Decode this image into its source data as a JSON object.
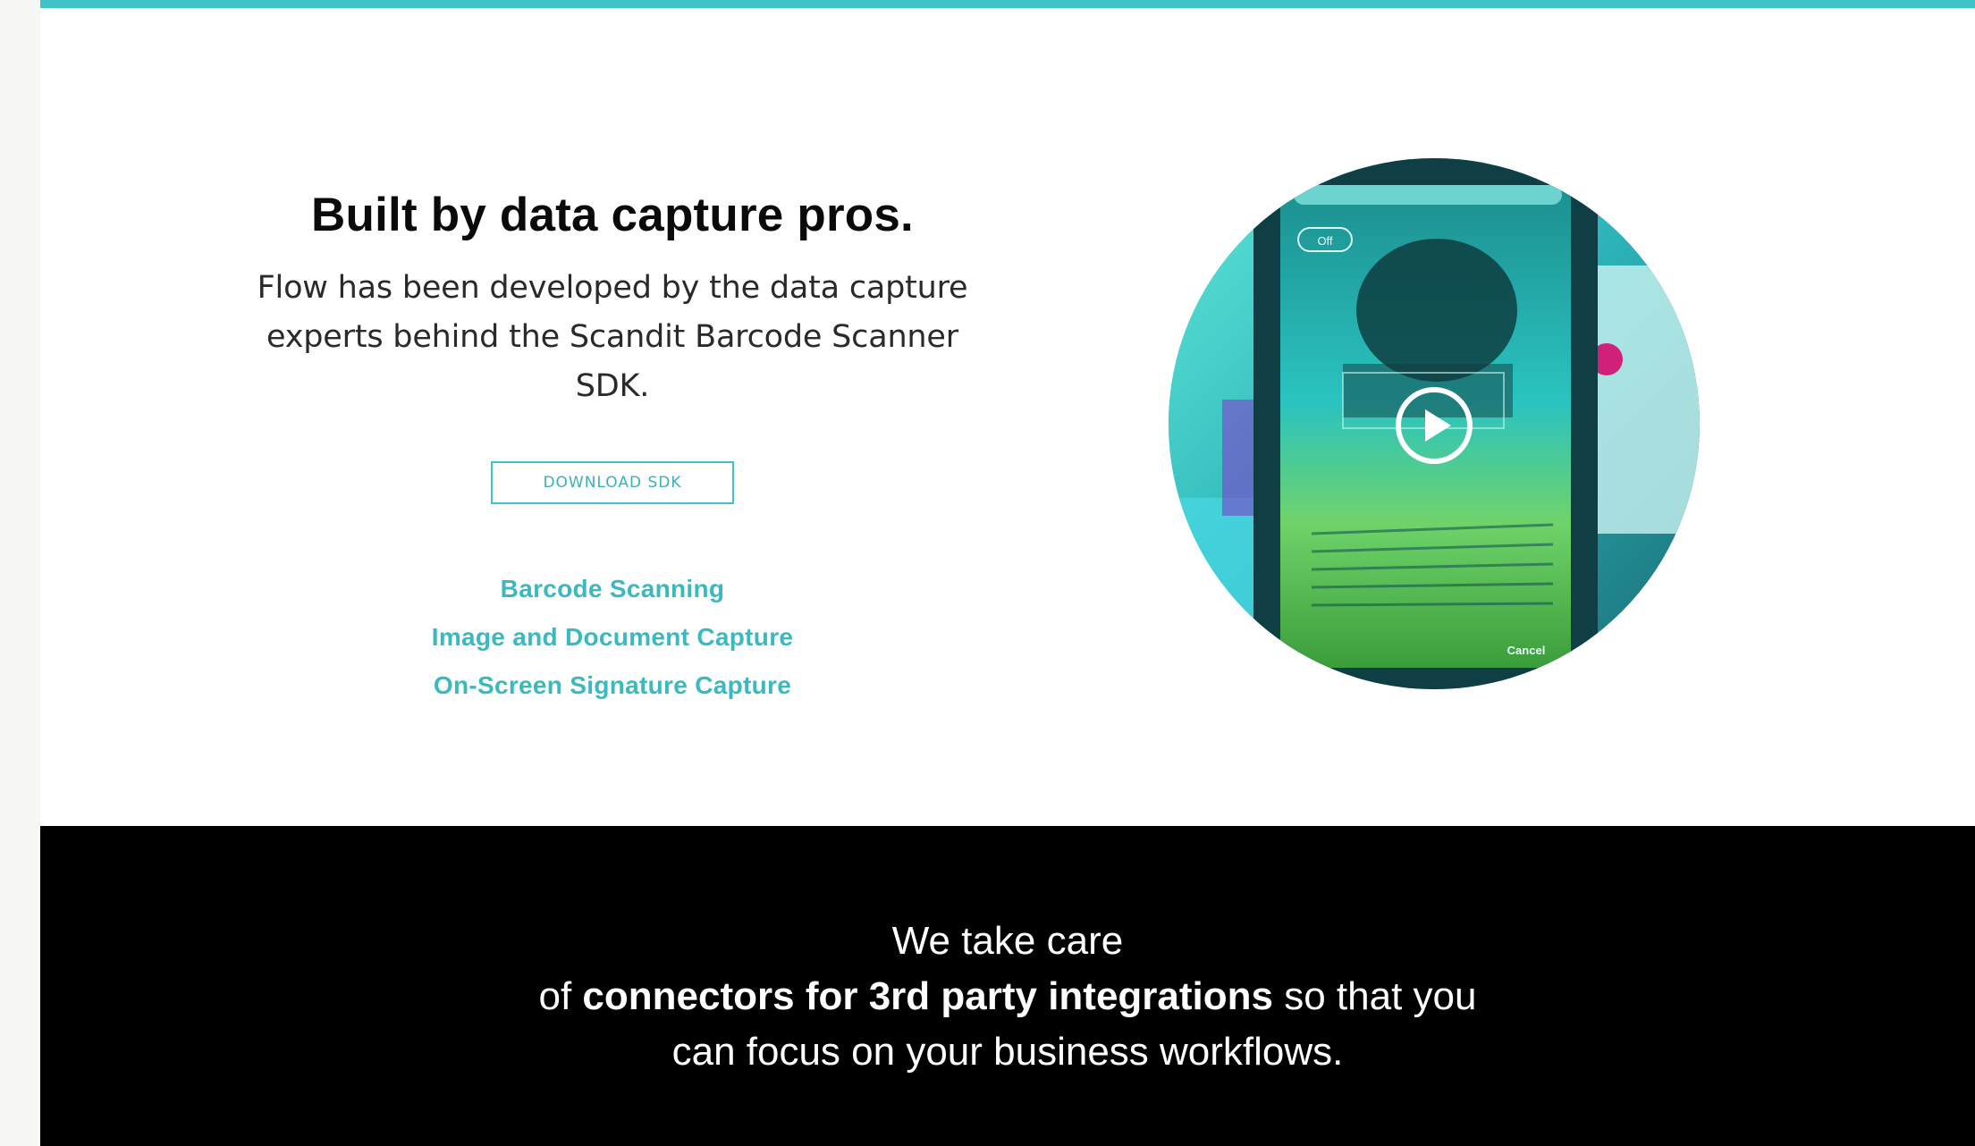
{
  "hero": {
    "title": "Built by data capture pros.",
    "description_line1": "Flow has been developed by the data capture",
    "description_line2": "experts behind the Scandit Barcode Scanner SDK.",
    "download_label": "DOWNLOAD SDK",
    "features": [
      "Barcode Scanning",
      "Image and Document Capture",
      "On-Screen Signature Capture"
    ]
  },
  "video": {
    "overlay_toggle": "Off",
    "overlay_cancel": "Cancel",
    "icon": "play-icon"
  },
  "band": {
    "line1": "We take care",
    "line2_prefix": "of ",
    "line2_bold": "connectors for 3rd party integrations",
    "line2_suffix": " so that you",
    "line3": "can focus on your business workflows."
  },
  "colors": {
    "accent": "#3fc3c9",
    "feature_link": "#3ab9c1",
    "band_background": "#000000",
    "text": "#0a0a0a"
  }
}
